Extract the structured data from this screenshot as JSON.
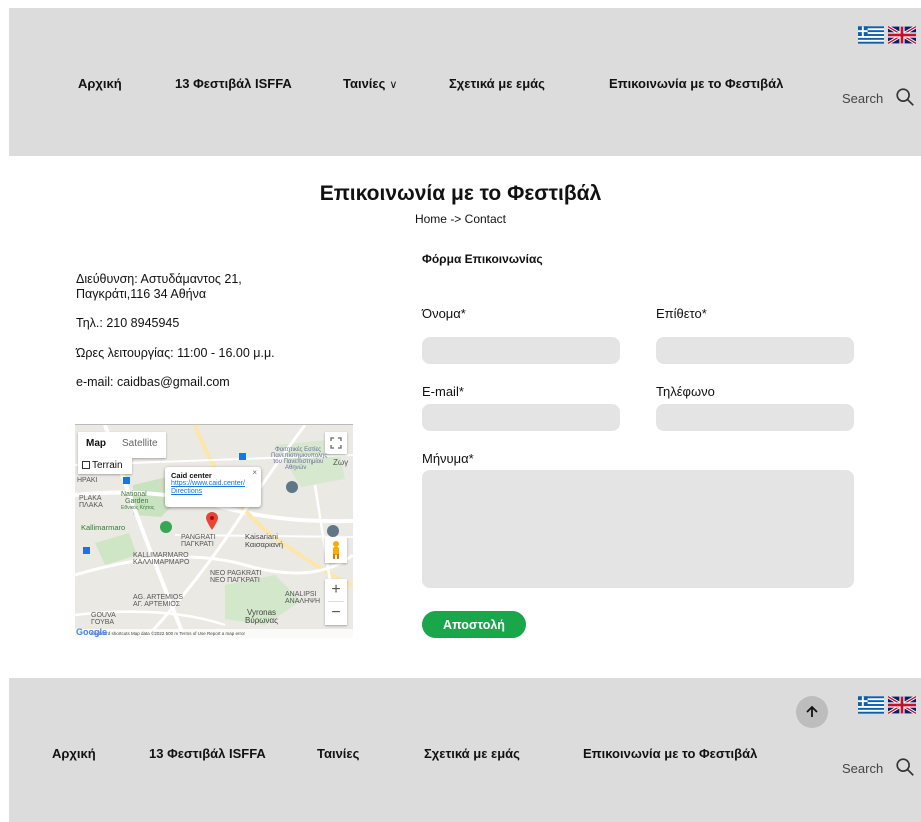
{
  "header": {
    "nav": [
      {
        "label": "Αρχική"
      },
      {
        "label": "13 Φεστιβάλ ISFFA"
      },
      {
        "label": "Ταινίες"
      },
      {
        "label": "Σχετικά με εμάς"
      },
      {
        "label": "Επικοινωνία με το Φεστιβάλ"
      }
    ],
    "films_chevron": "∨",
    "search_label": "Search"
  },
  "page": {
    "title": "Επικοινωνία με το Φεστιβάλ",
    "breadcrumb": "Home -> Contact"
  },
  "contact_info": {
    "address_line1": "Διεύθυνση: Αστυδάμαντος 21,",
    "address_line2": "Παγκράτι,116 34 Αθήνα",
    "phone": "Τηλ.: 210 8945945",
    "hours": "Ώρες λειτουργίας: 11:00 - 16.00 μ.μ.",
    "email": "e-mail: caidbas@gmail.com"
  },
  "map": {
    "tab_map": "Map",
    "tab_satellite": "Satellite",
    "terrain": "Terrain",
    "popup_title": "Caid center",
    "popup_link": "https://www.caid.center/",
    "popup_directions": "Directions",
    "zoom_in": "+",
    "zoom_out": "−",
    "labels": {
      "plaka": "PLAKA",
      "plaka_gr": "ΠΛΑΚΑ",
      "national_garden": "National",
      "national_garden2": "Garden",
      "national_garden_gr": "Εθνικός Κήπος",
      "kallimarmaro": "Kallimarmaro",
      "pangrati": "PANGRATI",
      "pangrati_gr": "ΠΑΓΚΡΑΤΙ",
      "kaisariani": "Kaisariani",
      "kaisariani_gr": "Καισαριανή",
      "kallimarmaro_area": "KALLIMARMARO",
      "kallimarmaro_area_gr": "ΚΑΛΛΙΜΑΡΜΑΡΟ",
      "neo_pagkrati": "NEO PAGKRATI",
      "neo_pagkrati_gr": "ΝΕΟ ΠΑΓΚΡΑΤΙ",
      "ag_artemios": "AG. ARTEMIOS",
      "ag_artemios_gr": "ΑΓ. ΑΡΤΕΜΙΟΣ",
      "analipsi": "ANALIPSI",
      "analipsi_gr": "ΑΝΑΛΗΨΗ",
      "gouva": "GOUVA",
      "gouva_gr": "ΓΟΥΒΑ",
      "vyronas": "Vyronas",
      "vyronas_gr": "Βύρωνας",
      "faculty1": "Φοιτητικές Εστίες",
      "faculty2": "Πανεπιστημιουπολης",
      "faculty3": "του Πανεπιστημίου",
      "faculty4": "Αθηνών",
      "zog": "Ζωγ",
      "hpaki": "ΗΡΑΚΙ"
    },
    "footer_text": "Keyboard shortcuts   Map data ©2022   500 m         Terms of Use   Report a map error",
    "google": "Google"
  },
  "form": {
    "heading": "Φόρμα Επικοινωνίας",
    "first_name_label": "Όνομα*",
    "last_name_label": "Επίθετο*",
    "email_label": "E-mail*",
    "phone_label": "Τηλέφωνο",
    "message_label": "Μήνυμα*",
    "first_name_value": "",
    "last_name_value": "",
    "email_value": "",
    "phone_value": "",
    "message_value": "",
    "submit_label": "Αποστολή"
  },
  "footer": {
    "nav": [
      {
        "label": "Αρχική"
      },
      {
        "label": "13 Φεστιβάλ ISFFA"
      },
      {
        "label": "Ταινίες"
      },
      {
        "label": "Σχετικά με εμάς"
      },
      {
        "label": "Επικοινωνία με το Φεστιβάλ"
      }
    ],
    "search_label": "Search"
  },
  "colors": {
    "header_bg": "#dcdcdc",
    "accent_green": "#1aa64a",
    "input_bg": "#e4e4e4"
  },
  "icons": [
    "flag-greece-icon",
    "flag-uk-icon",
    "search-icon",
    "arrow-up-icon",
    "map-pin-icon",
    "fullscreen-icon",
    "pegman-icon"
  ]
}
